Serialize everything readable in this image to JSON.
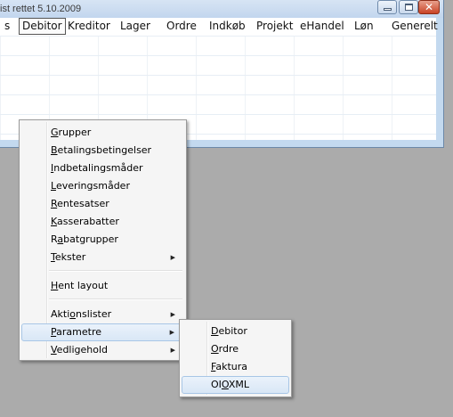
{
  "window": {
    "title": "ist rettet 5.10.2009",
    "minimize_glyph": "",
    "maximize_glyph": "",
    "close_glyph": "✕"
  },
  "menubar": {
    "items": [
      {
        "label": "s"
      },
      {
        "label": "Debitor",
        "active": true
      },
      {
        "label": "Kreditor"
      },
      {
        "label": "Lager"
      },
      {
        "label": "Ordre"
      },
      {
        "label": "Indkøb"
      },
      {
        "label": "Projekt"
      },
      {
        "label": "eHandel"
      },
      {
        "label": "Løn"
      },
      {
        "label": "Generelt"
      }
    ]
  },
  "debitor_menu": {
    "items": [
      {
        "pre": "",
        "key": "G",
        "post": "rupper"
      },
      {
        "pre": "",
        "key": "B",
        "post": "etalingsbetingelser"
      },
      {
        "pre": "",
        "key": "I",
        "post": "ndbetalingsmåder"
      },
      {
        "pre": "",
        "key": "L",
        "post": "everingsmåder"
      },
      {
        "pre": "",
        "key": "R",
        "post": "entesatser"
      },
      {
        "pre": "",
        "key": "K",
        "post": "asserabatter"
      },
      {
        "pre": "R",
        "key": "a",
        "post": "batgrupper"
      },
      {
        "pre": "",
        "key": "T",
        "post": "ekster",
        "submenu": true
      },
      {
        "pre": "",
        "key": "H",
        "post": "ent layout"
      },
      {
        "pre": "Akti",
        "key": "o",
        "post": "nslister",
        "submenu": true
      },
      {
        "pre": "",
        "key": "P",
        "post": "arametre",
        "submenu": true,
        "highlighted": true
      },
      {
        "pre": "",
        "key": "V",
        "post": "edligehold",
        "submenu": true
      }
    ],
    "submenu_arrow": "▶"
  },
  "parametre_submenu": {
    "items": [
      {
        "pre": "",
        "key": "D",
        "post": "ebitor"
      },
      {
        "pre": "",
        "key": "O",
        "post": "rdre"
      },
      {
        "pre": "",
        "key": "F",
        "post": "aktura"
      },
      {
        "pre": "OI",
        "key": "O",
        "post": "XML",
        "highlighted": true
      }
    ]
  }
}
